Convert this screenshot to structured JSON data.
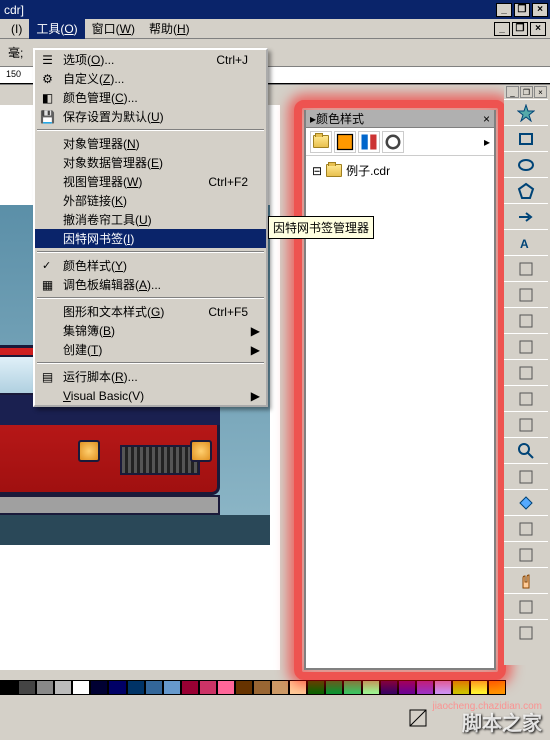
{
  "title_suffix": "cdr]",
  "window_controls": {
    "min": "_",
    "max": "❐",
    "close": "×"
  },
  "menubar": [
    {
      "label": "(I)"
    },
    {
      "label": "工具(O)",
      "u": true
    },
    {
      "label": "窗口(W)",
      "u": true
    },
    {
      "label": "帮助(H)",
      "u": true
    }
  ],
  "toolbar": {
    "unit_label": "毫;"
  },
  "ruler_mark": "150",
  "dropdown": {
    "sections": [
      [
        {
          "icon": "opts",
          "label": "选项(O)...",
          "u": "O",
          "shortcut": "Ctrl+J"
        },
        {
          "icon": "cust",
          "label": "自定义(Z)...",
          "u": "Z"
        },
        {
          "icon": "color",
          "label": "颜色管理(C)...",
          "u": "C"
        },
        {
          "icon": "save",
          "label": "保存设置为默认(U)",
          "u": "U"
        }
      ],
      [
        {
          "label": "对象管理器(N)",
          "u": "N"
        },
        {
          "label": "对象数据管理器(E)",
          "u": "E"
        },
        {
          "label": "视图管理器(W)",
          "u": "W",
          "shortcut": "Ctrl+F2"
        },
        {
          "label": "外部链接(K)",
          "u": "K"
        },
        {
          "label": "撤消卷帘工具(U)",
          "u": "U"
        },
        {
          "label": "因特网书签(I)",
          "u": "I",
          "hl": true
        }
      ],
      [
        {
          "check": true,
          "label": "颜色样式(Y)",
          "u": "Y"
        },
        {
          "icon": "pal",
          "label": "调色板编辑器(A)...",
          "u": "A"
        }
      ],
      [
        {
          "label": "图形和文本样式(G)",
          "u": "G",
          "shortcut": "Ctrl+F5"
        },
        {
          "label": "集锦簿(B)",
          "u": "B",
          "sub": true
        },
        {
          "label": "创建(T)",
          "u": "T",
          "sub": true
        }
      ],
      [
        {
          "icon": "script",
          "label": "运行脚本(R)...",
          "u": "R"
        },
        {
          "label": "Visual Basic(V)",
          "u": "V",
          "sub": true
        }
      ]
    ]
  },
  "tooltip": "因特网书签管理器",
  "docker": {
    "title": "颜色样式",
    "tree_item": "例子.cdr"
  },
  "palette": [
    "#000",
    "#444",
    "#888",
    "#bbb",
    "#fff",
    "#003",
    "#006",
    "#036",
    "#369",
    "#69c",
    "#903",
    "#c36",
    "#f69",
    "#630",
    "#963",
    "#c96",
    "#fc9",
    "#060",
    "#093",
    "#3c6",
    "#9f9",
    "#306",
    "#609",
    "#93c",
    "#c9f",
    "#cc0",
    "#ff3",
    "#f90"
  ],
  "right_tools": [
    "star",
    "rect",
    "ellipse",
    "polygon",
    "arrow",
    "text",
    "graph",
    "callout",
    "note",
    "line",
    "curve",
    "dimension",
    "connector",
    "zoom",
    "eyedrop",
    "fill",
    "outline",
    "interactive",
    "hand",
    "crop",
    "search"
  ],
  "watermark": "脚本之家",
  "watermark_url": "jiaocheng.chazidian.com"
}
